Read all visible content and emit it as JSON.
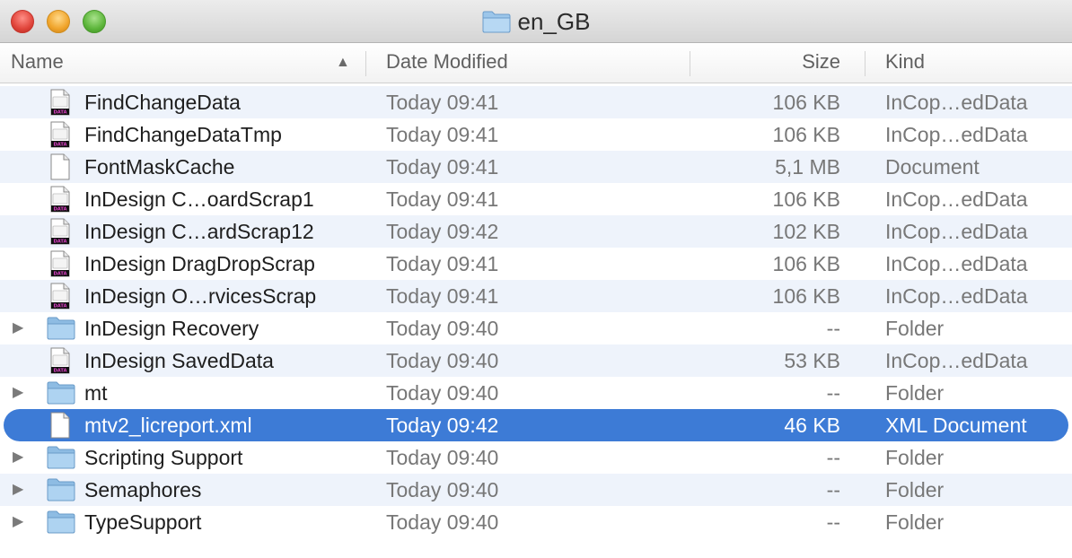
{
  "window": {
    "title": "en_GB"
  },
  "columns": {
    "name": "Name",
    "date": "Date Modified",
    "size": "Size",
    "kind": "Kind"
  },
  "rows": [
    {
      "name": "FindChangeData",
      "date": "Today 09:41",
      "size": "106 KB",
      "kind": "InCop…edData",
      "icon": "data-file-icon",
      "folder": false,
      "selected": false
    },
    {
      "name": "FindChangeDataTmp",
      "date": "Today 09:41",
      "size": "106 KB",
      "kind": "InCop…edData",
      "icon": "data-file-icon",
      "folder": false,
      "selected": false
    },
    {
      "name": "FontMaskCache",
      "date": "Today 09:41",
      "size": "5,1 MB",
      "kind": "Document",
      "icon": "document-icon",
      "folder": false,
      "selected": false
    },
    {
      "name": "InDesign C…oardScrap1",
      "date": "Today 09:41",
      "size": "106 KB",
      "kind": "InCop…edData",
      "icon": "data-file-icon",
      "folder": false,
      "selected": false
    },
    {
      "name": "InDesign C…ardScrap12",
      "date": "Today 09:42",
      "size": "102 KB",
      "kind": "InCop…edData",
      "icon": "data-file-icon",
      "folder": false,
      "selected": false
    },
    {
      "name": "InDesign DragDropScrap",
      "date": "Today 09:41",
      "size": "106 KB",
      "kind": "InCop…edData",
      "icon": "data-file-icon",
      "folder": false,
      "selected": false
    },
    {
      "name": "InDesign O…rvicesScrap",
      "date": "Today 09:41",
      "size": "106 KB",
      "kind": "InCop…edData",
      "icon": "data-file-icon",
      "folder": false,
      "selected": false
    },
    {
      "name": "InDesign Recovery",
      "date": "Today 09:40",
      "size": "--",
      "kind": "Folder",
      "icon": "folder-icon",
      "folder": true,
      "selected": false
    },
    {
      "name": "InDesign SavedData",
      "date": "Today 09:40",
      "size": "53 KB",
      "kind": "InCop…edData",
      "icon": "data-file-icon",
      "folder": false,
      "selected": false
    },
    {
      "name": "mt",
      "date": "Today 09:40",
      "size": "--",
      "kind": "Folder",
      "icon": "folder-icon",
      "folder": true,
      "selected": false
    },
    {
      "name": "mtv2_licreport.xml",
      "date": "Today 09:42",
      "size": "46 KB",
      "kind": "XML Document",
      "icon": "document-icon",
      "folder": false,
      "selected": true
    },
    {
      "name": "Scripting Support",
      "date": "Today 09:40",
      "size": "--",
      "kind": "Folder",
      "icon": "folder-icon",
      "folder": true,
      "selected": false
    },
    {
      "name": "Semaphores",
      "date": "Today 09:40",
      "size": "--",
      "kind": "Folder",
      "icon": "folder-icon",
      "folder": true,
      "selected": false
    },
    {
      "name": "TypeSupport",
      "date": "Today 09:40",
      "size": "--",
      "kind": "Folder",
      "icon": "folder-icon",
      "folder": true,
      "selected": false
    }
  ],
  "colors": {
    "selection": "#3d7bd6",
    "alt_row": "#eef3fb",
    "folder": "#7fb2de"
  }
}
